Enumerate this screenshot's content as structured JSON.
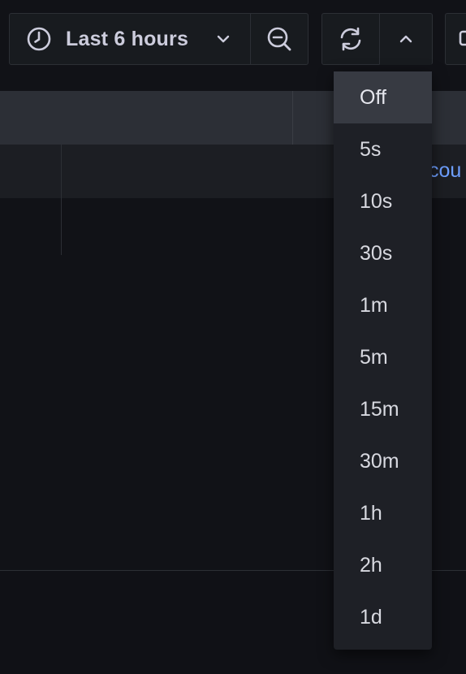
{
  "toolbar": {
    "time_range_label": "Last 6 hours",
    "icons": {
      "clock": "clock-icon",
      "chevron_down": "chevron-down-icon",
      "zoom_out": "zoom-out-icon",
      "refresh": "refresh-icon",
      "chevron_up": "chevron-up-icon",
      "extra": "tv-icon"
    }
  },
  "table": {
    "row_link_text": "cou"
  },
  "refresh_menu": {
    "selected": "Off",
    "options": [
      "Off",
      "5s",
      "10s",
      "30s",
      "1m",
      "5m",
      "15m",
      "30m",
      "1h",
      "2h",
      "1d"
    ]
  },
  "colors": {
    "background": "#111217",
    "link": "#6e9fff",
    "menu_background": "#1e2026",
    "menu_selected": "#373a42"
  }
}
